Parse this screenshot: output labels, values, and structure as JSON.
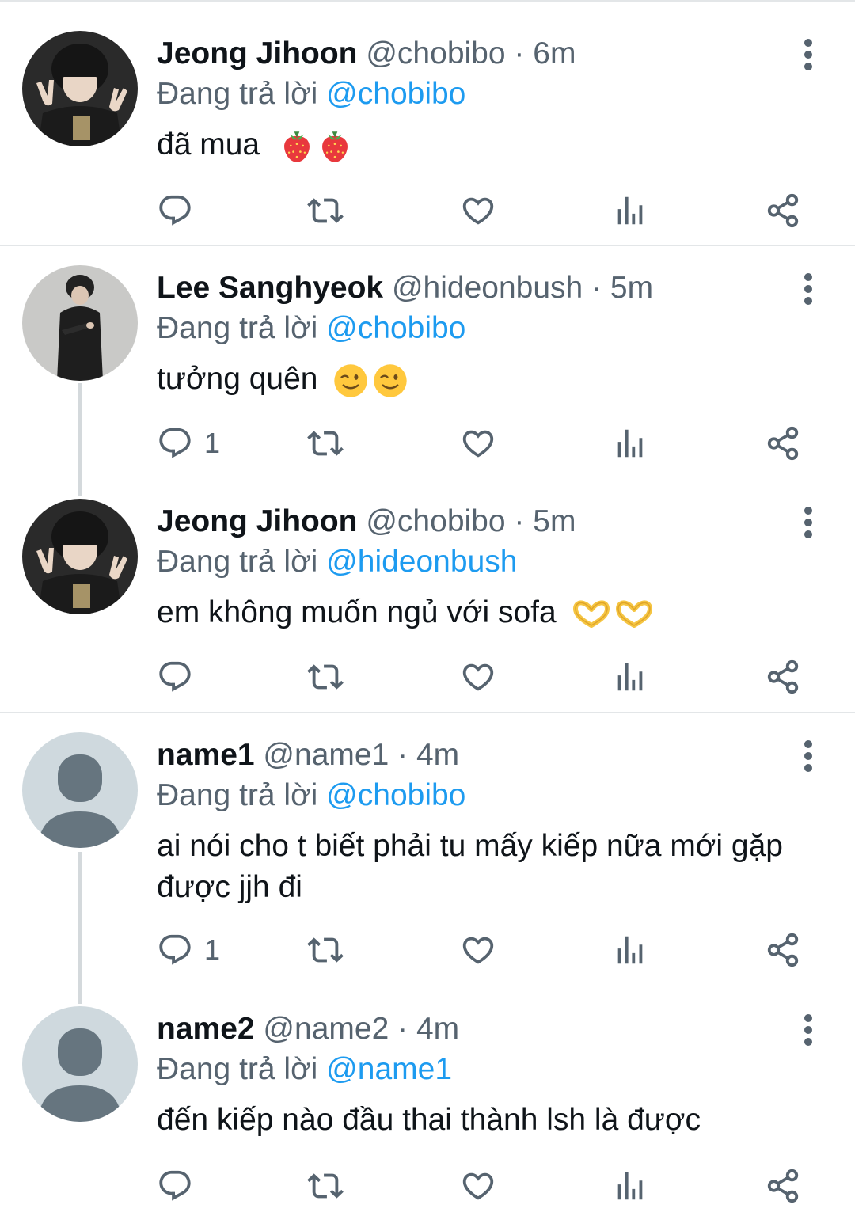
{
  "replying_prefix": "Đang trả lời",
  "colors": {
    "link": "#1d9bf0",
    "secondary_text": "#56636f",
    "divider": "#e3e6e8",
    "thread_line": "#d4d9dc"
  },
  "tweets": [
    {
      "name": "Jeong Jihoon",
      "handle": "@chobibo",
      "separator": "·",
      "time": "6m",
      "reply_to": "@chobibo",
      "text": "đã mua",
      "emoji": [
        "strawberry",
        "strawberry"
      ],
      "reply_count": "",
      "avatar": "photo-person-peace-sign"
    },
    {
      "name": "Lee Sanghyeok",
      "handle": "@hideonbush",
      "separator": "·",
      "time": "5m",
      "reply_to": "@chobibo",
      "text": "tưởng quên",
      "emoji": [
        "winking-face",
        "winking-face"
      ],
      "reply_count": "1",
      "avatar": "photo-person-dark-outfit"
    },
    {
      "name": "Jeong Jihoon",
      "handle": "@chobibo",
      "separator": "·",
      "time": "5m",
      "reply_to": "@hideonbush",
      "text": "em không muốn ngủ với sofa",
      "emoji": [
        "heart-hands",
        "heart-hands"
      ],
      "reply_count": "",
      "avatar": "photo-person-peace-sign"
    },
    {
      "name": "name1",
      "handle": "@name1",
      "separator": "·",
      "time": "4m",
      "reply_to": "@chobibo",
      "text": "ai nói cho t biết phải tu mấy kiếp nữa mới gặp được jjh đi",
      "emoji": [],
      "reply_count": "1",
      "avatar": "default-avatar"
    },
    {
      "name": "name2",
      "handle": "@name2",
      "separator": "·",
      "time": "4m",
      "reply_to": "@name1",
      "text": "đến kiếp nào đầu thai thành lsh là được",
      "emoji": [],
      "reply_count": "",
      "avatar": "default-avatar"
    }
  ]
}
